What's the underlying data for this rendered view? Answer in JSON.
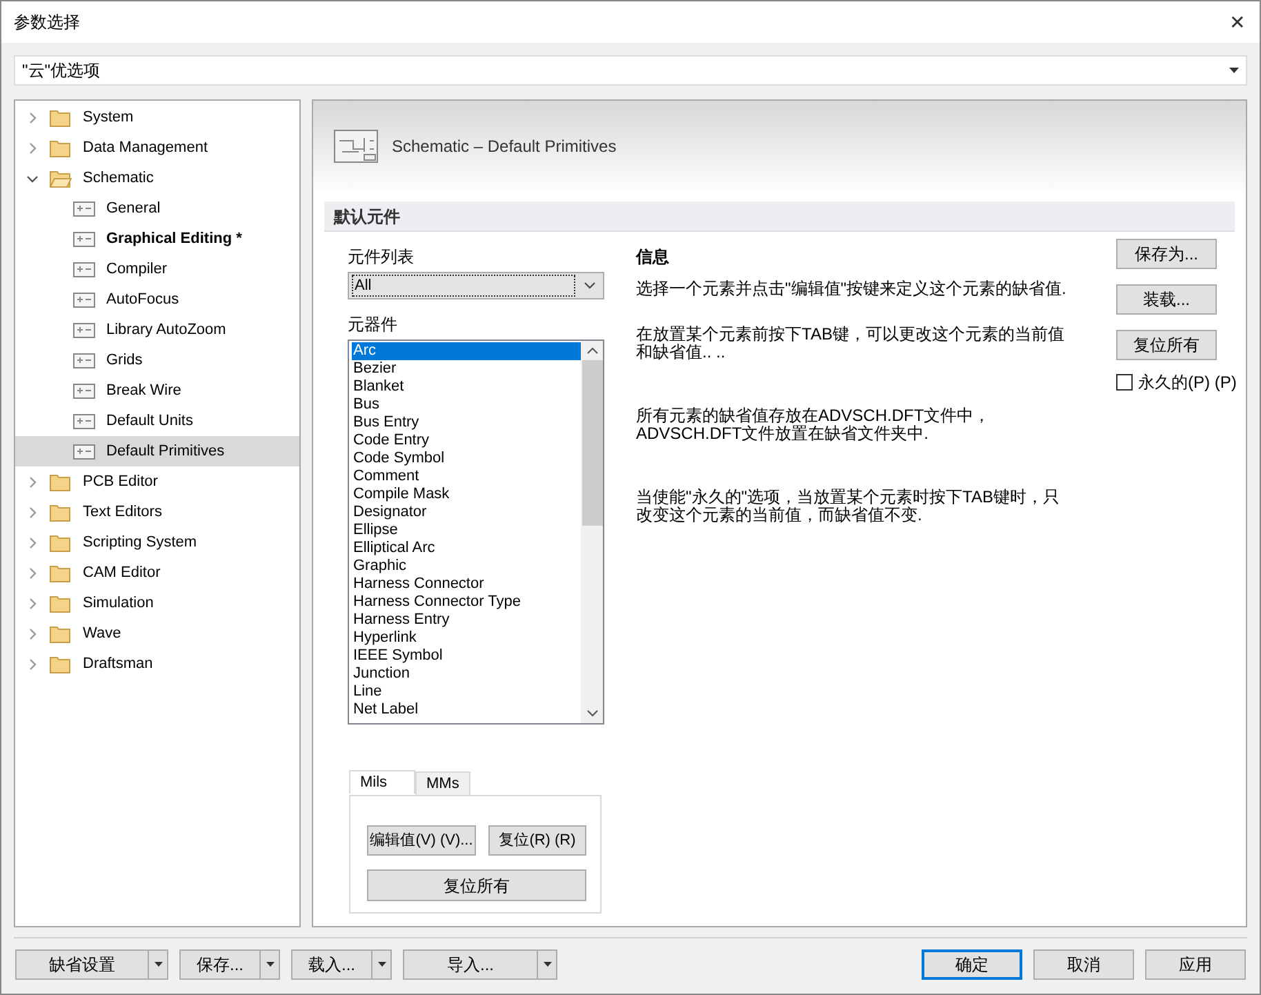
{
  "window": {
    "title": "参数选择",
    "close": "✕"
  },
  "search": {
    "value": "\"云\"优选项"
  },
  "tree": [
    {
      "label": "System",
      "kind": "folder",
      "expanded": false,
      "selected": false
    },
    {
      "label": "Data Management",
      "kind": "folder",
      "expanded": false,
      "selected": false
    },
    {
      "label": "Schematic",
      "kind": "folder",
      "expanded": true,
      "selected": false,
      "children": [
        {
          "label": "General",
          "kind": "page",
          "selected": false,
          "modified": false
        },
        {
          "label": "Graphical Editing *",
          "kind": "page",
          "selected": false,
          "modified": true
        },
        {
          "label": "Compiler",
          "kind": "page",
          "selected": false,
          "modified": false
        },
        {
          "label": "AutoFocus",
          "kind": "page",
          "selected": false,
          "modified": false
        },
        {
          "label": "Library AutoZoom",
          "kind": "page",
          "selected": false,
          "modified": false
        },
        {
          "label": "Grids",
          "kind": "page",
          "selected": false,
          "modified": false
        },
        {
          "label": "Break Wire",
          "kind": "page",
          "selected": false,
          "modified": false
        },
        {
          "label": "Default Units",
          "kind": "page",
          "selected": false,
          "modified": false
        },
        {
          "label": "Default Primitives",
          "kind": "page",
          "selected": true,
          "modified": false
        }
      ]
    },
    {
      "label": "PCB Editor",
      "kind": "folder",
      "expanded": false,
      "selected": false
    },
    {
      "label": "Text Editors",
      "kind": "folder",
      "expanded": false,
      "selected": false
    },
    {
      "label": "Scripting System",
      "kind": "folder",
      "expanded": false,
      "selected": false
    },
    {
      "label": "CAM Editor",
      "kind": "folder",
      "expanded": false,
      "selected": false
    },
    {
      "label": "Simulation",
      "kind": "folder",
      "expanded": false,
      "selected": false
    },
    {
      "label": "Wave",
      "kind": "folder",
      "expanded": false,
      "selected": false
    },
    {
      "label": "Draftsman",
      "kind": "folder",
      "expanded": false,
      "selected": false
    }
  ],
  "page": {
    "title": "Schematic – Default Primitives",
    "section": "默认元件",
    "list_label": "元件列表",
    "list_value": "All",
    "primitives_label": "元器件",
    "primitives": [
      {
        "label": "Arc",
        "selected": true
      },
      {
        "label": "Bezier",
        "selected": false
      },
      {
        "label": "Blanket",
        "selected": false
      },
      {
        "label": "Bus",
        "selected": false
      },
      {
        "label": "Bus Entry",
        "selected": false
      },
      {
        "label": "Code Entry",
        "selected": false
      },
      {
        "label": "Code Symbol",
        "selected": false
      },
      {
        "label": "Comment",
        "selected": false
      },
      {
        "label": "Compile Mask",
        "selected": false
      },
      {
        "label": "Designator",
        "selected": false
      },
      {
        "label": "Ellipse",
        "selected": false
      },
      {
        "label": "Elliptical Arc",
        "selected": false
      },
      {
        "label": "Graphic",
        "selected": false
      },
      {
        "label": "Harness Connector",
        "selected": false
      },
      {
        "label": "Harness Connector Type",
        "selected": false
      },
      {
        "label": "Harness Entry",
        "selected": false
      },
      {
        "label": "Hyperlink",
        "selected": false
      },
      {
        "label": "IEEE Symbol",
        "selected": false
      },
      {
        "label": "Junction",
        "selected": false
      },
      {
        "label": "Line",
        "selected": false
      },
      {
        "label": "Net Label",
        "selected": false
      }
    ],
    "unit_tabs": [
      {
        "label": "Mils",
        "selected": true
      },
      {
        "label": "MMs",
        "selected": false
      }
    ],
    "edit_button": "编辑值(V) (V)...",
    "reset_button": "复位(R) (R)",
    "reset_all_button": "复位所有",
    "info_title": "信息",
    "info": [
      "选择一个元素并点击\"编辑值\"按键来定义这个元素的缺省值.",
      "在放置某个元素前按下TAB键，可以更改这个元素的当前值和缺省值.. ..",
      "所有元素的缺省值存放在ADVSCH.DFT文件中，ADVSCH.DFT文件放置在缺省文件夹中.",
      "当使能\"永久的\"选项，当放置某个元素时按下TAB键时，只改变这个元素的当前值，而缺省值不变."
    ],
    "side_buttons": [
      "保存为...",
      "装载...",
      "复位所有"
    ],
    "permanent": {
      "label": "永久的(P) (P)",
      "checked": false
    }
  },
  "footer": {
    "menu_buttons": [
      "缺省设置",
      "保存...",
      "载入...",
      "导入..."
    ],
    "buttons": [
      {
        "label": "确定",
        "default": true
      },
      {
        "label": "取消",
        "default": false
      },
      {
        "label": "应用",
        "default": false
      }
    ]
  }
}
